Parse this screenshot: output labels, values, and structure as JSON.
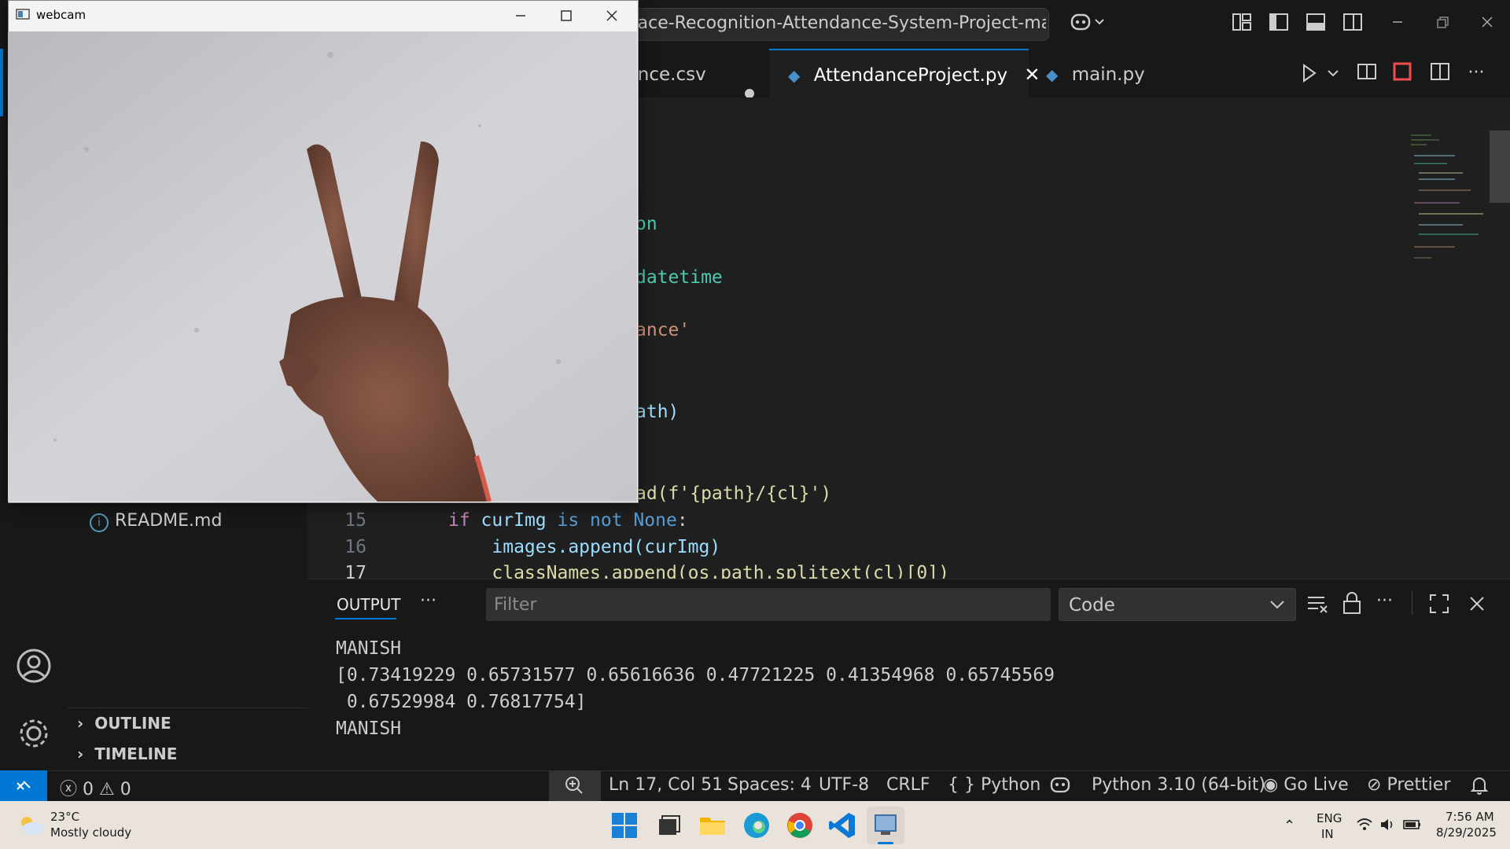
{
  "titlebar": {
    "search_text": "Face-Recognition-Attendance-System-Project-main"
  },
  "tabs": [
    {
      "label": "Attendance.csv",
      "modified": true
    },
    {
      "label": "AttendanceProject.py",
      "active": true
    },
    {
      "label": "main.py"
    }
  ],
  "editor": {
    "visible_fragments": [
      {
        "text": "on"
      },
      {
        "text": "datetime"
      },
      {
        "text": "ance'"
      },
      {
        "text": "ath)"
      },
      {
        "text": "ad(f'{path}/{cl}')"
      }
    ],
    "lines": [
      {
        "num": "15",
        "code_kw": "if",
        "code_rest": " curImg ",
        "code_kw2": "is not",
        "code_none": " None",
        "code_end": ":"
      },
      {
        "num": "16",
        "code": "    images.append(curImg)"
      },
      {
        "num": "17",
        "code": "    classNames.append(os.path.splitext(cl)[0])"
      }
    ]
  },
  "explorer": {
    "file_readme": "README.md",
    "outline": "OUTLINE",
    "timeline": "TIMELINE"
  },
  "panel": {
    "tab_output": "OUTPUT",
    "filter_placeholder": "Filter",
    "channel": "Code",
    "lines": [
      "MANISH",
      "[0.73419229 0.65731577 0.65616636 0.47721225 0.41354968 0.65745569",
      " 0.67529984 0.76817754]",
      "MANISH"
    ]
  },
  "statusbar": {
    "errors": "0",
    "warnings": "0",
    "position": "Ln 17, Col 51",
    "spaces": "Spaces: 4",
    "encoding": "UTF-8",
    "eol": "CRLF",
    "language": "Python",
    "interpreter": "Python 3.10 (64-bit)",
    "golive": "Go Live",
    "prettier": "Prettier"
  },
  "webcam": {
    "title": "webcam"
  },
  "taskbar": {
    "temp": "23°C",
    "weather": "Mostly cloudy",
    "lang1": "ENG",
    "lang2": "IN",
    "time": "7:56 AM",
    "date": "8/29/2025"
  },
  "colors": {
    "accent": "#0078d4",
    "keyword": "#569cd6",
    "string": "#ce9178",
    "function": "#dcdcaa",
    "variable": "#9cdcfe",
    "teal": "#4ec9b0"
  }
}
